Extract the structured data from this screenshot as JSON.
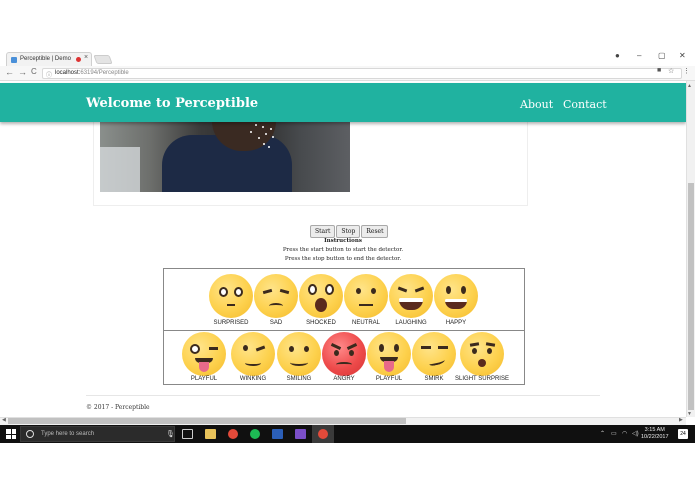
{
  "browser": {
    "tab_title": "Perceptible | Demo",
    "tab_close": "×",
    "url_host": "localhost:",
    "url_path": "63194/Perceptible",
    "window_controls": {
      "profile": "●",
      "minimize": "–",
      "maximize": "▢",
      "close": "✕"
    },
    "nav": {
      "back": "←",
      "forward": "→",
      "reload": "C"
    }
  },
  "navbar": {
    "brand": "Welcome to Perceptible",
    "links": [
      "About",
      "Contact"
    ],
    "color": "#20b2a0"
  },
  "controls": {
    "start": "Start",
    "stop": "Stop",
    "reset": "Reset"
  },
  "instructions": {
    "title": "Instructions",
    "line1": "Press the start button to start the detector.",
    "line2": "Press the stop button to end the detector."
  },
  "emotions": {
    "row1": [
      "SURPRISED",
      "SAD",
      "SHOCKED",
      "NEUTRAL",
      "LAUGHING",
      "HAPPY"
    ],
    "row2": [
      "PLAYFUL",
      "WINKING",
      "SMILING",
      "ANGRY",
      "PLAYFUL",
      "SMIRK",
      "SLIGHT SURPRISE"
    ]
  },
  "footer": {
    "text": "© 2017 - Perceptible"
  },
  "taskbar": {
    "search_placeholder": "Type here to search",
    "time": "3:15 AM",
    "date": "10/22/2017",
    "notifications": "24"
  }
}
